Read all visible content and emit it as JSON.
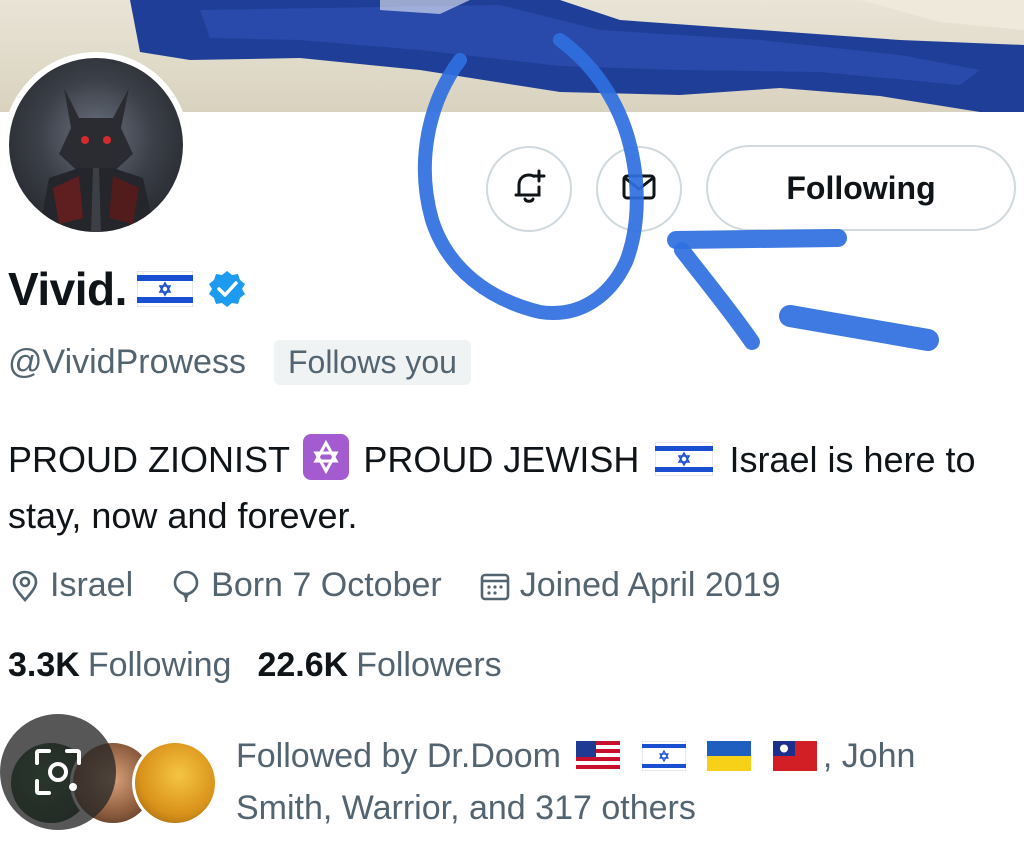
{
  "profile": {
    "display_name": "Vivid.",
    "handle": "@VividProwess",
    "follows_you_badge": "Follows you",
    "verified": true,
    "name_flag": "israel-flag"
  },
  "actions": {
    "notify_icon": "bell-plus-icon",
    "message_icon": "mail-icon",
    "following_button": "Following"
  },
  "bio": {
    "part1": "PROUD ZIONIST",
    "emoji1": "star-of-david-emoji",
    "part2": "PROUD JEWISH",
    "flag": "israel-flag",
    "part3": "Israel is here to stay, now and forever."
  },
  "meta": {
    "location": "Israel",
    "birthday": "Born 7 October",
    "joined": "Joined April 2019"
  },
  "stats": {
    "following_count": "3.3K",
    "following_label": "Following",
    "followers_count": "22.6K",
    "followers_label": "Followers"
  },
  "followed_by": {
    "prefix": "Followed by Dr.Doom",
    "flags": [
      "usa-flag",
      "israel-flag",
      "ukraine-flag",
      "taiwan-flag"
    ],
    "suffix": ", John Smith, Warrior, and 317 others"
  },
  "colors": {
    "accent_blue": "#1d9bf0",
    "scribble_blue": "#2f6fe0",
    "text_primary": "#0f1419",
    "text_secondary": "#536471",
    "border": "#cfd9de"
  }
}
